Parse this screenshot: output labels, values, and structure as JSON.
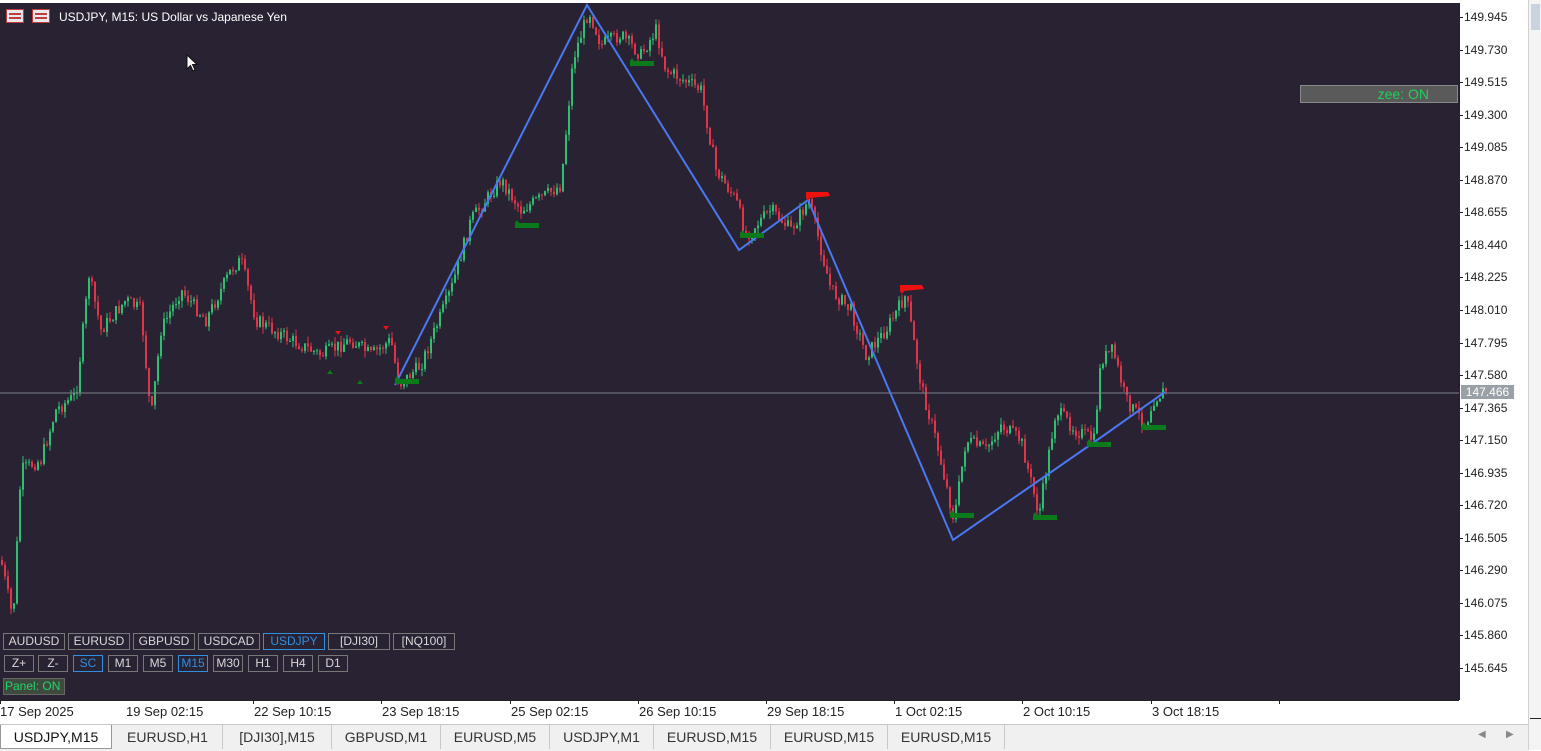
{
  "chart": {
    "title": "USDJPY, M15:  US Dollar vs Japanese Yen",
    "current_price": "147.466",
    "price_labels": [
      "149.945",
      "149.730",
      "149.515",
      "149.300",
      "149.085",
      "148.870",
      "148.655",
      "148.440",
      "148.225",
      "148.010",
      "147.795",
      "147.580",
      "147.365",
      "147.150",
      "146.935",
      "146.720",
      "146.505",
      "146.290",
      "146.075",
      "145.860",
      "145.645"
    ],
    "time_labels": [
      "17 Sep 2025",
      "19 Sep 02:15",
      "22 Sep 10:15",
      "23 Sep 18:15",
      "25 Sep 02:15",
      "26 Sep 10:15",
      "29 Sep 18:15",
      "1 Oct 02:15",
      "2 Oct 10:15",
      "3 Oct 18:15"
    ],
    "zee_status": "zee: ON",
    "colors": {
      "background": "#282232",
      "bull": "#2fbf71",
      "bear": "#e0344a",
      "zigzag": "#4a78f0",
      "buy_flag": "#0a7a1a",
      "sell_flag": "#ee1111"
    }
  },
  "panel": {
    "symbols": [
      {
        "label": "AUDUSD",
        "active": false
      },
      {
        "label": "EURUSD",
        "active": false
      },
      {
        "label": "GBPUSD",
        "active": false
      },
      {
        "label": "USDCAD",
        "active": false
      },
      {
        "label": "USDJPY",
        "active": true
      },
      {
        "label": "[DJI30]",
        "active": false
      },
      {
        "label": "[NQ100]",
        "active": false
      }
    ],
    "controls": [
      {
        "label": "Z+",
        "active": false
      },
      {
        "label": "Z-",
        "active": false
      },
      {
        "label": "SC",
        "active": true
      },
      {
        "label": "M1",
        "active": false
      },
      {
        "label": "M5",
        "active": false
      },
      {
        "label": "M15",
        "active": true
      },
      {
        "label": "M30",
        "active": false
      },
      {
        "label": "H1",
        "active": false
      },
      {
        "label": "H4",
        "active": false
      },
      {
        "label": "D1",
        "active": false
      }
    ],
    "toggle": "Panel: ON"
  },
  "tabs": [
    "USDJPY,M15",
    "EURUSD,H1",
    "[DJI30],M15",
    "GBPUSD,M1",
    "EURUSD,M5",
    "USDJPY,M1",
    "EURUSD,M15",
    "EURUSD,M15",
    "EURUSD,M15"
  ],
  "active_tab": 0,
  "icons": {
    "title_left": "chart-list-icon",
    "title_right": "chart-grid-icon",
    "cursor": "mouse-cursor-icon",
    "tab_prev": "scroll-left-icon",
    "tab_next": "scroll-right-icon"
  }
}
